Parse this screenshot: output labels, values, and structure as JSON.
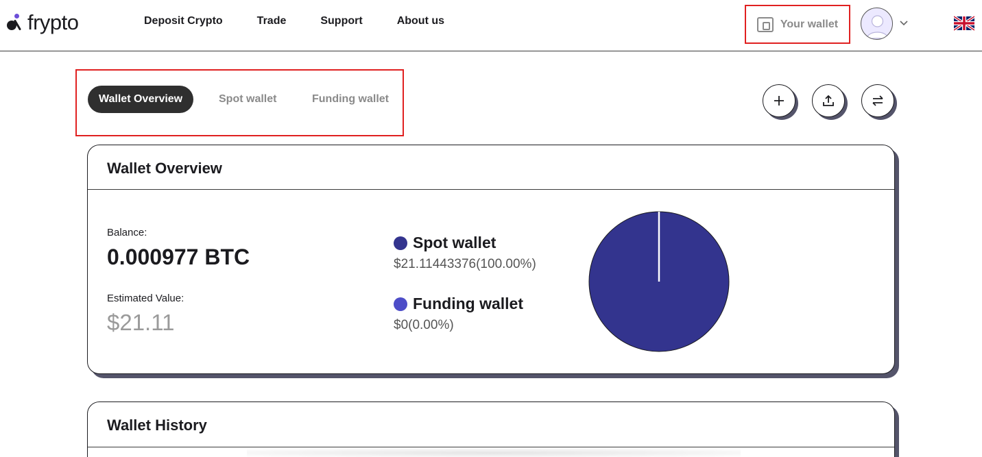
{
  "header": {
    "logo_text": "frypto",
    "nav": [
      "Deposit Crypto",
      "Trade",
      "Support",
      "About us"
    ],
    "wallet_label": "Your wallet",
    "icons": {
      "wallet": "wallet-icon",
      "avatar": "user-avatar",
      "chevron": "chevron-down-icon",
      "flag": "uk-flag-icon"
    }
  },
  "tabs": {
    "active": "Wallet Overview",
    "spot": "Spot wallet",
    "funding": "Funding wallet"
  },
  "actions": {
    "icons": [
      "plus-icon",
      "upload-icon",
      "transfer-icon"
    ]
  },
  "overview": {
    "title": "Wallet Overview",
    "balance_label": "Balance:",
    "balance_value": "0.000977 BTC",
    "estimated_label": "Estimated Value:",
    "estimated_value": "$21.11",
    "legend": [
      {
        "name": "Spot wallet",
        "amount": "$21.11443376(100.00%)",
        "color": "#33348e"
      },
      {
        "name": "Funding wallet",
        "amount": "$0(0.00%)",
        "color": "#4d4dc8"
      }
    ]
  },
  "chart_data": {
    "type": "pie",
    "categories": [
      "Spot wallet",
      "Funding wallet"
    ],
    "values": [
      21.11443376,
      0
    ],
    "colors": [
      "#33348e",
      "#4d4dc8"
    ]
  },
  "history": {
    "title": "Wallet History"
  }
}
